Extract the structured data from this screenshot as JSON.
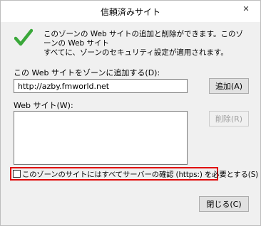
{
  "window": {
    "title": "信頼済みサイト",
    "close_glyph": "✕"
  },
  "description": {
    "line1": "このゾーンの Web サイトの追加と削除ができます。このゾーンの Web サイト",
    "line2": "すべてに、ゾーンのセキュリティ設定が適用されます。"
  },
  "add_site": {
    "label": "この Web サイトをゾーンに追加する(D):",
    "input_value": "http://azby.fmworld.net",
    "add_button": "追加(A)"
  },
  "websites": {
    "label": "Web サイト(W):",
    "items": [],
    "remove_button": "削除(R)"
  },
  "https_checkbox": {
    "label": "このゾーンのサイトにはすべてサーバーの確認 (https:) を必要とする(S)",
    "checked": false
  },
  "close_button": "閉じる(C)",
  "colors": {
    "highlight_border": "#e00000",
    "checkmark": "#3aa83a"
  },
  "icons": {
    "checkmark": "checkmark-icon",
    "close": "close-icon"
  }
}
